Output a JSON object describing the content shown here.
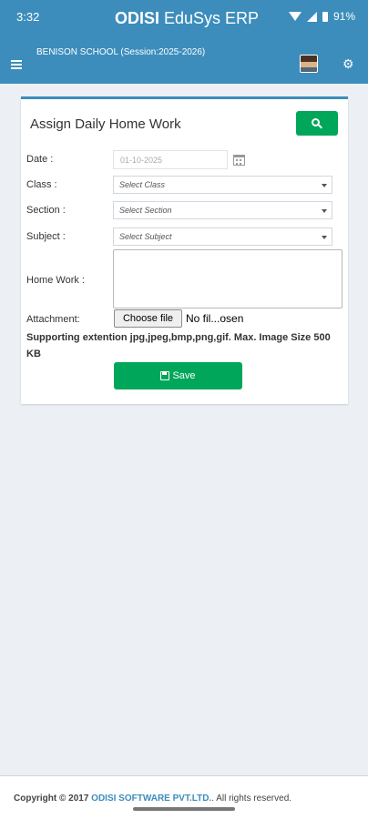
{
  "status_bar": {
    "time": "3:32",
    "battery": "91%"
  },
  "app": {
    "title_bold": "ODISI",
    "title_rest": " EduSys ERP"
  },
  "header": {
    "school": "BENISON SCHOOL (Session:2025-2026)"
  },
  "form": {
    "title": "Assign Daily Home Work",
    "date_label": "Date :",
    "date_value": "01-10-2025",
    "class_label": "Class :",
    "class_value": "Select Class",
    "section_label": "Section :",
    "section_value": "Select Section",
    "subject_label": "Subject :",
    "subject_value": "Select Subject",
    "homework_label": "Home Work :",
    "attachment_label": "Attachment:",
    "choose_file": "Choose file",
    "file_status": "No fil...osen",
    "supporting_note": "Supporting extention jpg,jpeg,bmp,png,gif. Max. Image Size 500 KB",
    "save_label": "Save"
  },
  "footer": {
    "prefix": "Copyright © 2017 ",
    "company": "ODISI SOFTWARE PVT.LTD.",
    "suffix": ". All rights reserved."
  },
  "colors": {
    "header": "#3c8dbc",
    "success": "#00a65a"
  }
}
